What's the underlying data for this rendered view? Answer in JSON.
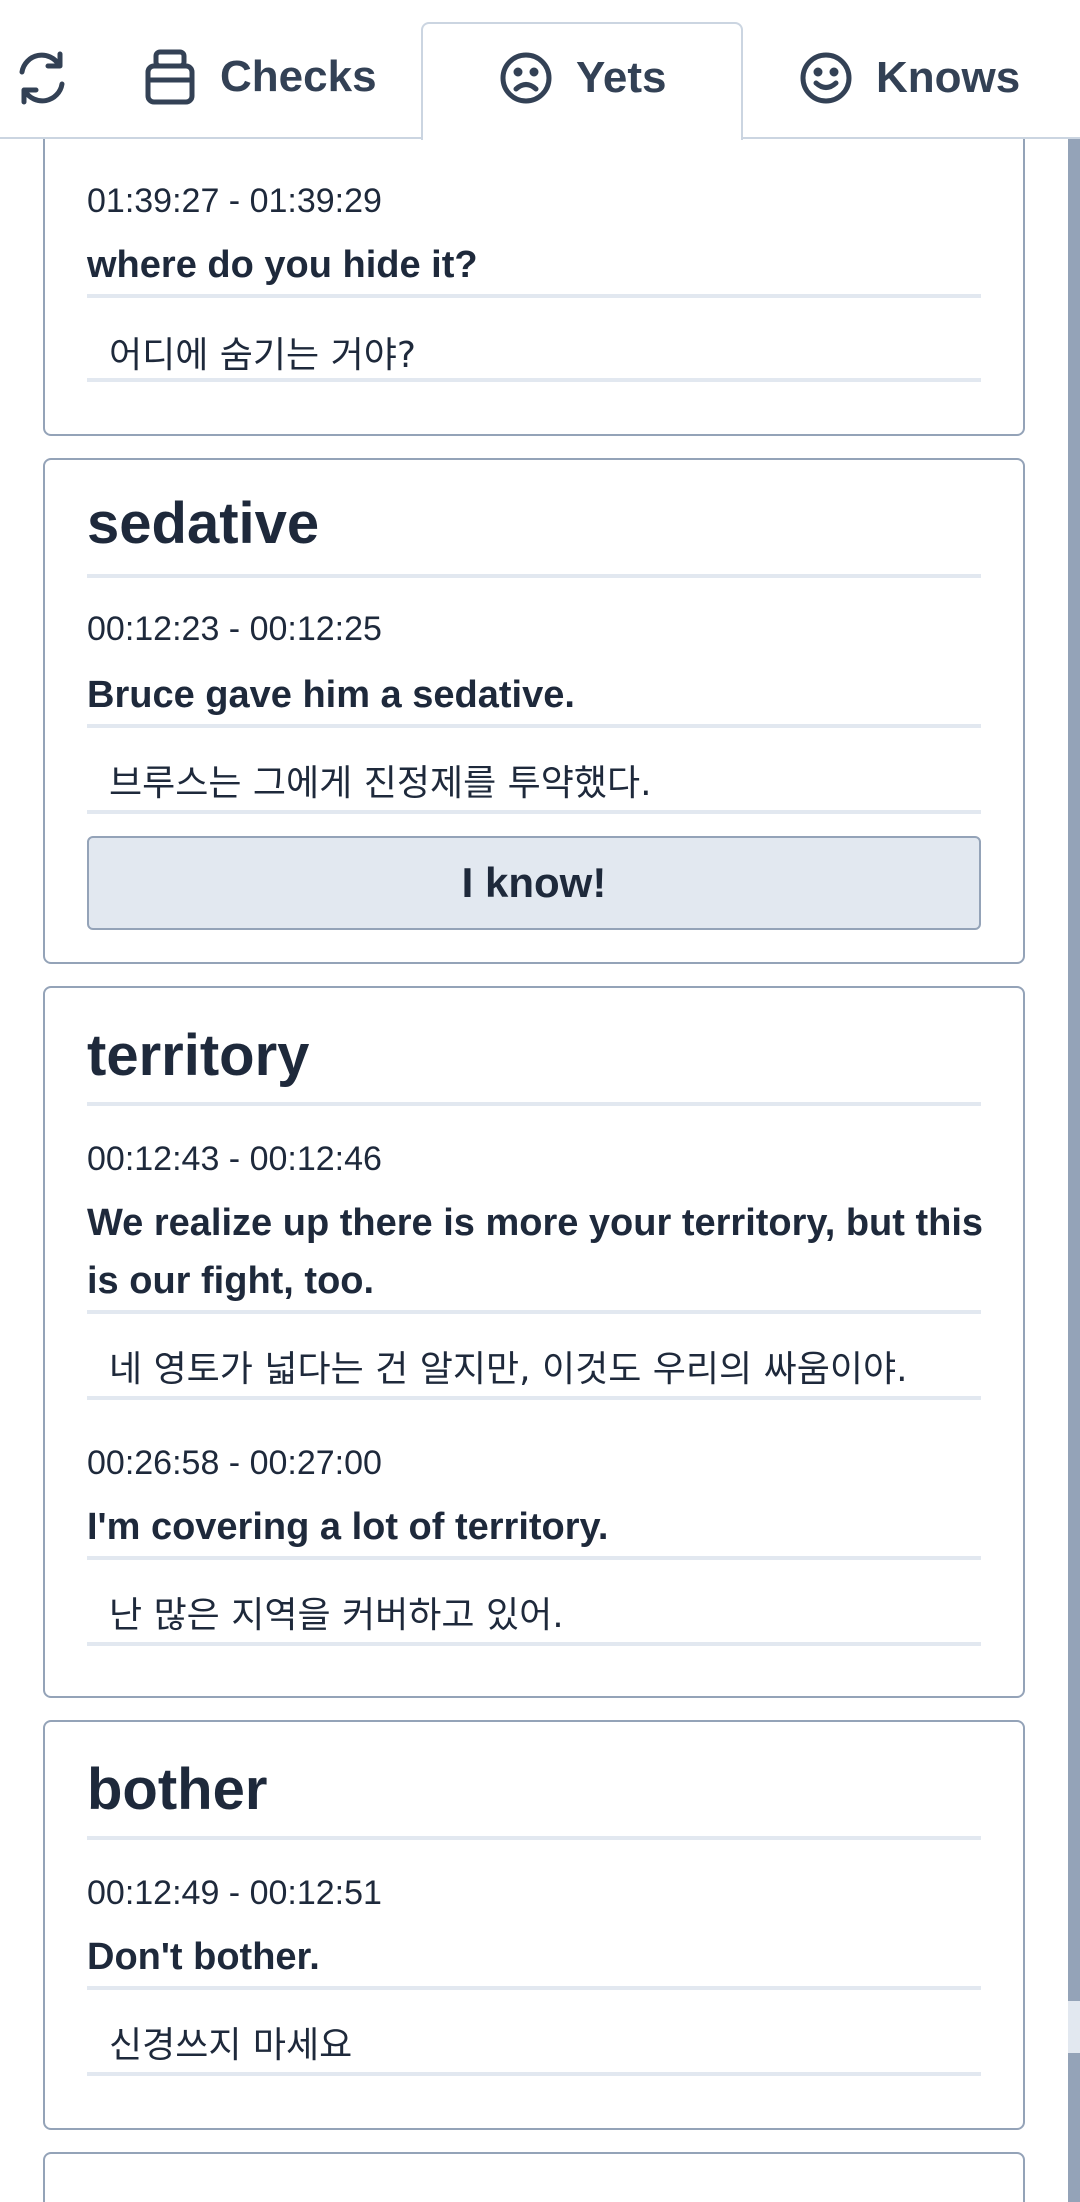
{
  "tabs": {
    "checks_label": "Checks",
    "yets_label": "Yets",
    "knows_label": "Knows"
  },
  "cards": [
    {
      "word": "",
      "entries": [
        {
          "time": "01:39:27 - 01:39:29",
          "en": "where do you hide it?",
          "ko": "어디에 숨기는 거야?"
        }
      ]
    },
    {
      "word": "sedative",
      "entries": [
        {
          "time": "00:12:23 - 00:12:25",
          "en": "Bruce gave him a sedative.",
          "ko": "브루스는 그에게 진정제를 투약했다."
        }
      ],
      "button": "I know!"
    },
    {
      "word": "territory",
      "entries": [
        {
          "time": "00:12:43 - 00:12:46",
          "en": "We realize up there is more your territory, but this is our fight, too.",
          "ko": "네 영토가 넓다는 건 알지만, 이것도 우리의 싸움이야."
        },
        {
          "time": "00:26:58 - 00:27:00",
          "en": "I'm covering a lot of territory.",
          "ko": "난 많은 지역을 커버하고 있어."
        }
      ]
    },
    {
      "word": "bother",
      "entries": [
        {
          "time": "00:12:49 - 00:12:51",
          "en": "Don't bother.",
          "ko": "신경쓰지 마세요"
        }
      ]
    }
  ],
  "colors": {
    "text": "#1e293b",
    "border": "#94a3b8",
    "divider": "#e2e8f0",
    "button_bg": "#e2e8f0"
  }
}
